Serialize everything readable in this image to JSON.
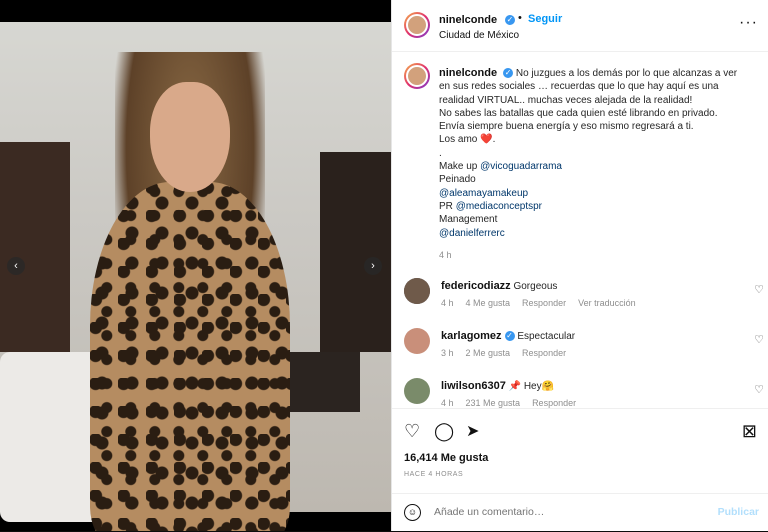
{
  "post": {
    "username": "ninelconde",
    "follow_label": "Seguir",
    "location": "Ciudad de México",
    "caption_lines": [
      "No juzgues a los demás por lo que alcanzas a ver",
      "en sus redes sociales … recuerdas que lo que hay aquí es una",
      "realidad VIRTUAL.. muchas veces alejada de la realidad!",
      "No sabes las batallas que cada quien esté librando en privado.",
      "Envía siempre buena energía y eso mismo regresará a ti.",
      "Los amo ❤️.",
      ".",
      "Make up",
      "Peinado",
      "@aleamayamakeup",
      "PR",
      "Management",
      "@danielferrerc"
    ],
    "mentions": {
      "makeup": "@vicoguadarrama",
      "pr": "@mediaconceptspr"
    },
    "caption_time": "4 h"
  },
  "comments": [
    {
      "user": "federicodiazz",
      "text": "Gorgeous",
      "time": "4 h",
      "likes": "4 Me gusta",
      "reply": "Responder",
      "translate": "Ver traducción",
      "verified": false
    },
    {
      "user": "karlagomez",
      "text": "Espectacular",
      "time": "3 h",
      "likes": "2 Me gusta",
      "reply": "Responder",
      "verified": true
    },
    {
      "user": "liwilson6307",
      "text": "📌 Hey🤗",
      "time": "4 h",
      "likes": "231 Me gusta",
      "reply": "Responder",
      "verified": false
    }
  ],
  "footer": {
    "likes": "16,414 Me gusta",
    "ago": "HACE 4 HORAS",
    "comment_placeholder": "Añade un comentario…",
    "publish": "Publicar"
  },
  "colors": {
    "accent": "#0095f6",
    "mention": "#00376b",
    "verified": "#3897f0"
  }
}
